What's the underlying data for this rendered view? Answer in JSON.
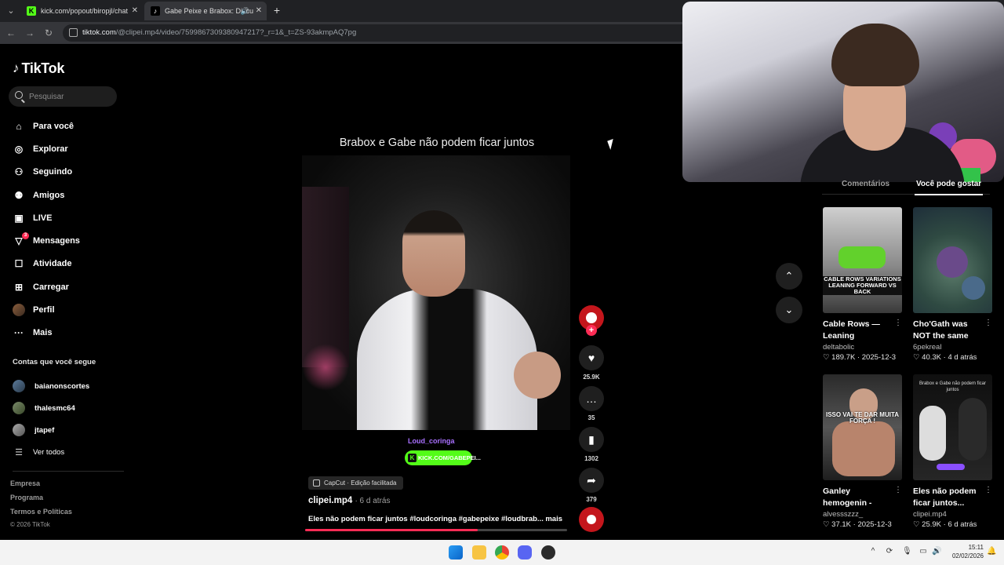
{
  "browser": {
    "tabs": [
      {
        "title": "kick.com/popout/biropjl/chat",
        "favicon": "K"
      },
      {
        "title": "Gabe Peixe e Brabox: Discu",
        "favicon": "♪"
      }
    ],
    "url_host": "tiktok.com",
    "url_path": "/@clipei.mp4/video/7599867309380947217?_r=1&_t=ZS-93akmpAQ7pg"
  },
  "sidebar": {
    "logo": "TikTok",
    "search_placeholder": "Pesquisar",
    "nav": [
      {
        "label": "Para você",
        "icon": "home-icon"
      },
      {
        "label": "Explorar",
        "icon": "compass-icon"
      },
      {
        "label": "Seguindo",
        "icon": "following-icon"
      },
      {
        "label": "Amigos",
        "icon": "friends-icon"
      },
      {
        "label": "LIVE",
        "icon": "live-icon"
      },
      {
        "label": "Mensagens",
        "icon": "messages-icon",
        "badge": "3"
      },
      {
        "label": "Atividade",
        "icon": "activity-icon"
      },
      {
        "label": "Carregar",
        "icon": "upload-icon"
      },
      {
        "label": "Perfil",
        "icon": "profile-avatar"
      },
      {
        "label": "Mais",
        "icon": "more-icon"
      }
    ],
    "following_title": "Contas que você segue",
    "following": [
      "baianonscortes",
      "thalesmc64",
      "jtapef"
    ],
    "see_all": "Ver todos",
    "footer": [
      "Empresa",
      "Programa",
      "Termos e Políticas"
    ],
    "copyright": "© 2026 TikTok"
  },
  "video": {
    "title": "Brabox e Gabe não podem ficar juntos",
    "watermark": "Loud_coringa",
    "kick_pill": "KICK.COM/GABEPEI...",
    "capcut": "CapCut · Edição facilitada",
    "author": "clipei.mp4",
    "ago": "· 6 d atrás",
    "description": "Eles não podem ficar juntos #loudcoringa #gabepeixe #loudbrab...",
    "more": "mais",
    "progress": 0.66,
    "likes": "25.9K",
    "comments": "35",
    "saves": "1302",
    "shares": "379"
  },
  "right_panel": {
    "tabs": [
      "Comentários",
      "Você pode gostar"
    ],
    "cards": [
      {
        "title": "Cable Rows — Leaning Forward...",
        "author": "deltabolic",
        "likes": "189.7K",
        "date": "2025-12-3",
        "overlay": "CABLE ROWS VARIATIONS LEANING FORWARD VS BACK"
      },
      {
        "title": "Cho'Gath was NOT the same after th...",
        "author": "6pekreal",
        "likes": "40.3K",
        "date": "4 d atrás",
        "overlay": ""
      },
      {
        "title": "Ganley hemogenin - #musculação...",
        "author": "alvessszzz_",
        "likes": "37.1K",
        "date": "2025-12-3",
        "overlay": "ISSO VAI TE DAR MUITA FORÇA !"
      },
      {
        "title": "Eles não podem ficar juntos...",
        "author": "clipei.mp4",
        "likes": "25.9K",
        "date": "6 d atrás",
        "overlay": "Brabox e Gabe não podem ficar juntos"
      }
    ]
  },
  "taskbar": {
    "time": "15:11",
    "date": "02/02/2026"
  },
  "colors": {
    "accent": "#fe2c55",
    "kick_green": "#53fc18",
    "twitch_purple": "#a970ff"
  }
}
